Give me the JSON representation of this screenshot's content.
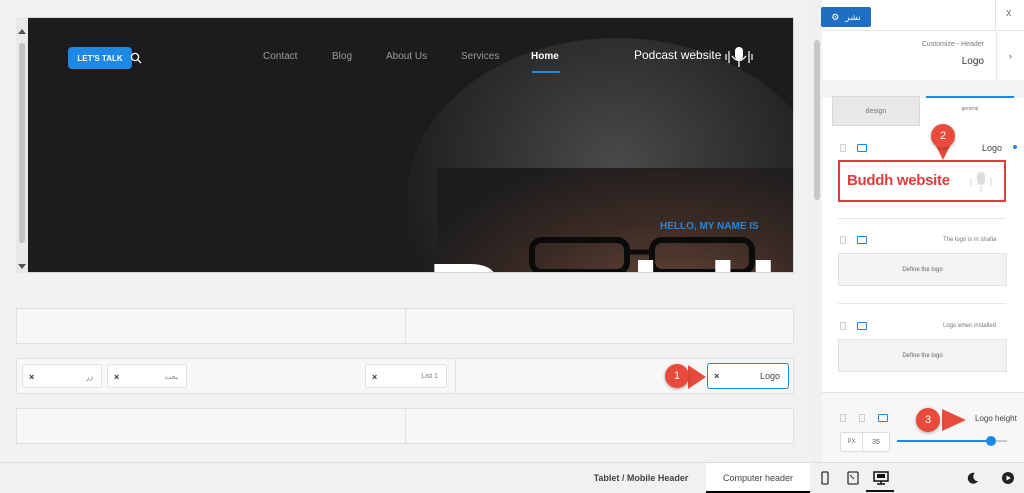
{
  "preview": {
    "brand": "Podcast website",
    "cta": "LET'S TALK",
    "hello": "HELLO, MY NAME IS",
    "big_text": "Buddh",
    "nav": [
      "Contact",
      "Blog",
      "About Us",
      "Services",
      "Home"
    ],
    "active_nav": "Home"
  },
  "builder": {
    "row2": {
      "chip_left_1": "زر",
      "chip_left_2": "بحث",
      "chip_mid": "List 1",
      "chip_logo": "Logo"
    }
  },
  "panel": {
    "close": "X",
    "publish": "نشر",
    "breadcrumb": "Customize - Header",
    "title": "Logo",
    "tabs": [
      "design",
      "general"
    ],
    "logo_label": "Logo",
    "logo_preview_text": "Buddh website",
    "field2_label": "The logo is in shafia",
    "field2_box": "Define the logo",
    "field3_label": "Logo when installed",
    "field3_box": "Define the logo",
    "height_label": "Logo height",
    "height_unit": "PX",
    "height_value": "35",
    "slider_value": 0.85
  },
  "annotations": [
    "1",
    "2",
    "3"
  ],
  "bottombar": {
    "tab_mobile": "Tablet / Mobile Header",
    "tab_computer": "Computer header"
  },
  "colors": {
    "accent": "#1e88e5",
    "annotation": "#e84b3c",
    "dark_bg": "#1c1c1e"
  }
}
